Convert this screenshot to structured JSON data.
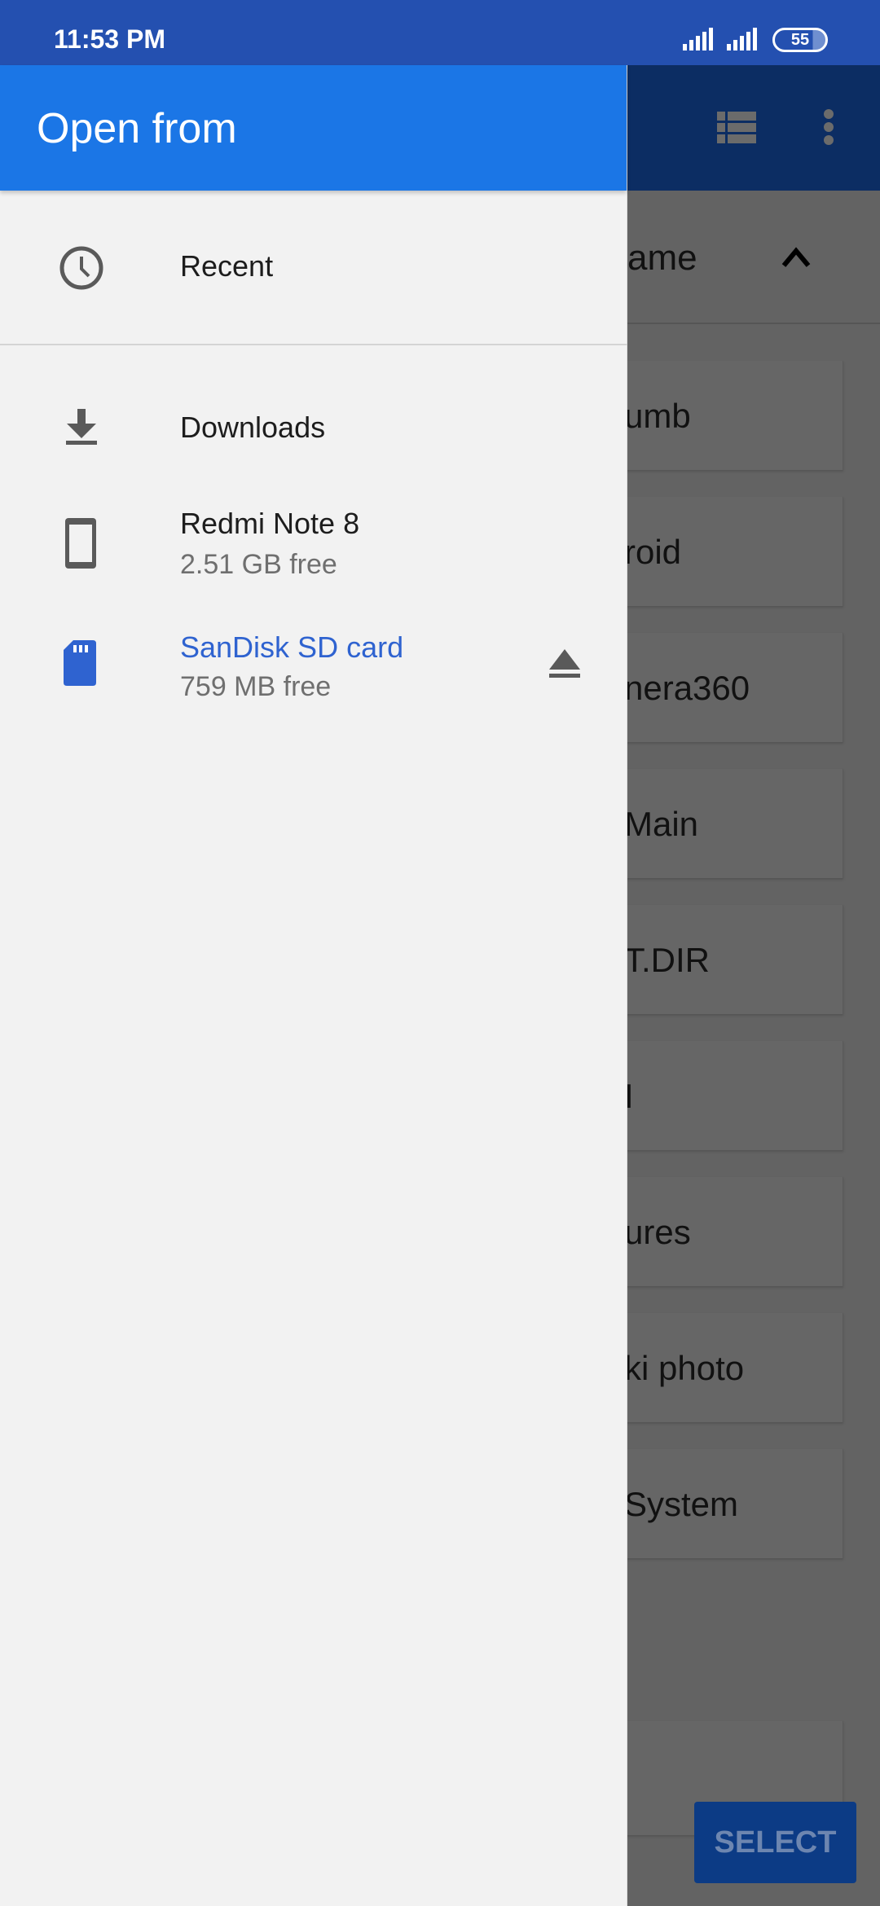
{
  "status_bar": {
    "time": "11:53 PM",
    "battery": "55"
  },
  "drawer": {
    "title": "Open from",
    "items": [
      {
        "label": "Recent",
        "icon": "clock-icon"
      },
      {
        "label": "Downloads",
        "icon": "download-icon"
      },
      {
        "label": "Redmi Note 8",
        "sub": "2.51 GB free",
        "icon": "phone-icon"
      },
      {
        "label": "SanDisk SD card",
        "sub": "759 MB free",
        "icon": "sd-card-icon",
        "action_icon": "eject-icon",
        "selected": true
      }
    ]
  },
  "background": {
    "sort_label": "ame",
    "folders": [
      "umb",
      "roid",
      "nera360",
      "Main",
      "T.DIR",
      "I",
      "ures",
      "ki photo",
      "System"
    ],
    "select_label": "SELECT"
  },
  "colors": {
    "status_bar": "#2450b0",
    "drawer_header": "#1b76e6",
    "accent": "#2f63d0"
  }
}
